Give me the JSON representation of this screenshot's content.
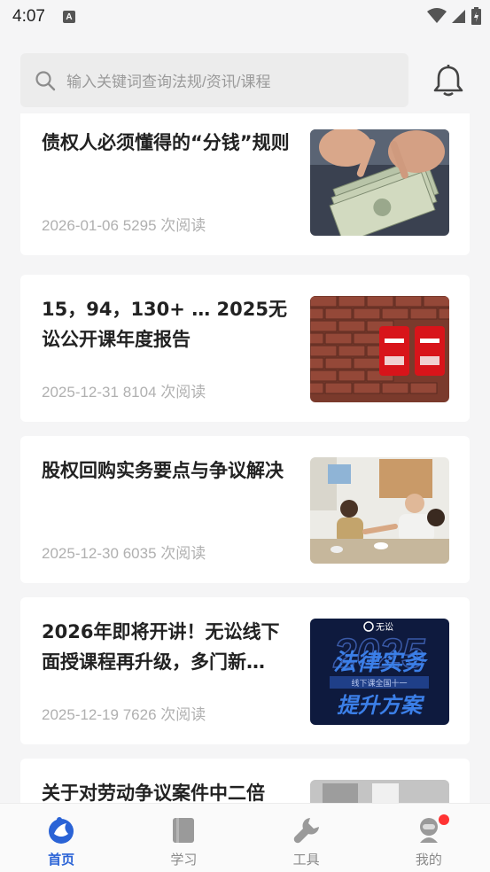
{
  "status_bar": {
    "time": "4:07",
    "notif_icon": "A"
  },
  "search": {
    "placeholder": "输入关键词查询法规/资讯/课程"
  },
  "articles": [
    {
      "title": "债权人必须懂得的“分钱”规则",
      "date": "2026-01-06",
      "views": "5295 次阅读",
      "thumb": "money-photo"
    },
    {
      "title": "15，94，130+ … 2025无讼公开课年度报告",
      "date": "2025-12-31",
      "views": "8104 次阅读",
      "thumb": "mailbox-photo"
    },
    {
      "title": "股权回购实务要点与争议解决",
      "date": "2025-12-30",
      "views": "6035 次阅读",
      "thumb": "meeting-photo"
    },
    {
      "title": "2026年即将开讲！无讼线下面授课程再升级，多门新…",
      "date": "2025-12-19",
      "views": "7626 次阅读",
      "thumb": "course-banner",
      "banner": {
        "logo": "无讼",
        "year": "2025",
        "line1": "法律实务",
        "strip": "线下课全国十一",
        "line2": "提升方案"
      }
    },
    {
      "title": "关于对劳动争议案件中二倍",
      "date": "",
      "views": "",
      "thumb": "office-photo"
    }
  ],
  "tabs": [
    {
      "label": "首页",
      "icon": "home-icon",
      "active": true
    },
    {
      "label": "学习",
      "icon": "book-icon",
      "active": false
    },
    {
      "label": "工具",
      "icon": "wrench-icon",
      "active": false
    },
    {
      "label": "我的",
      "icon": "profile-icon",
      "active": false
    }
  ],
  "colors": {
    "accent": "#2a63d6",
    "badge": "#ff3333"
  }
}
